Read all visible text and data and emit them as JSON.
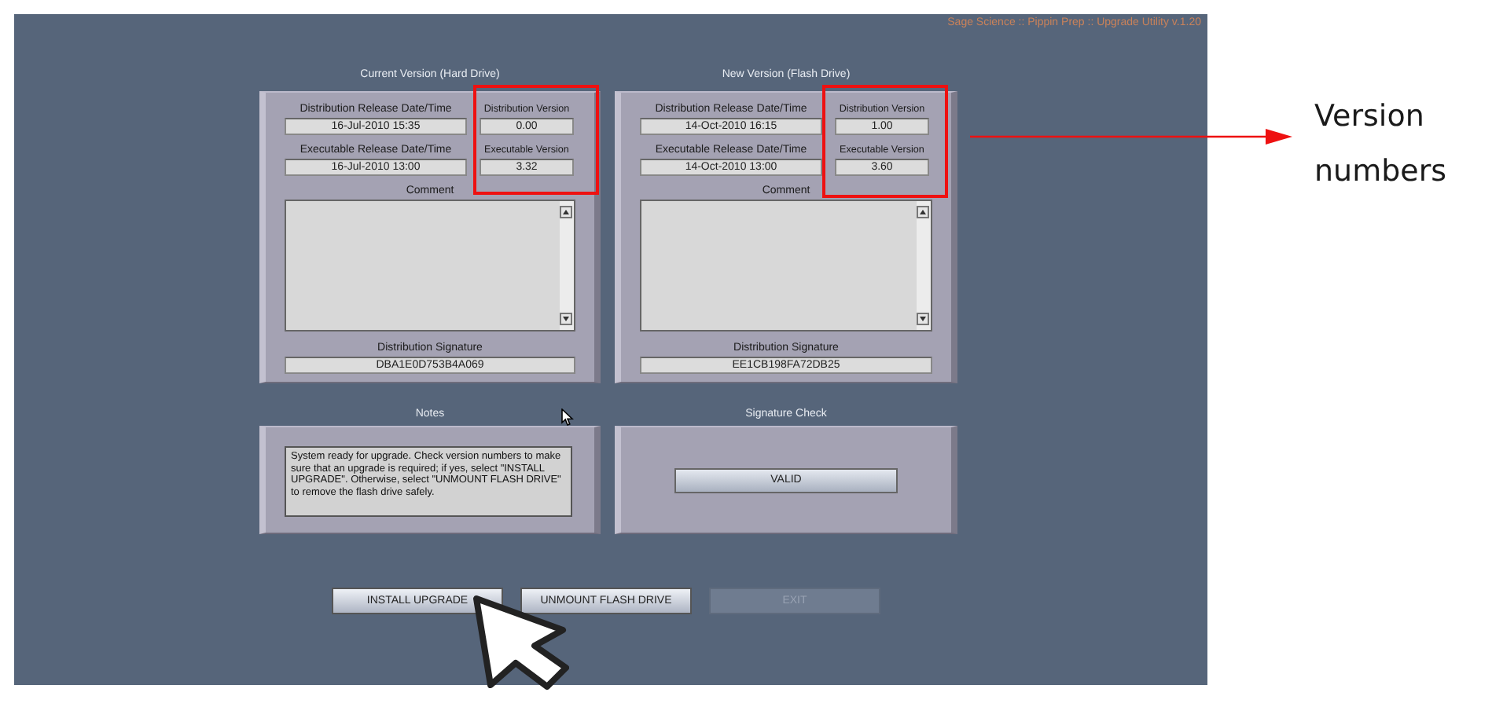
{
  "app_title": "Sage Science :: Pippin Prep :: Upgrade Utility v.1.20",
  "version_panels": [
    {
      "title": "Current Version (Hard Drive)",
      "dist_date_label": "Distribution Release Date/Time",
      "dist_date": "16-Jul-2010   15:35",
      "dist_version_label": "Distribution Version",
      "dist_version": "0.00",
      "exe_date_label": "Executable Release Date/Time",
      "exe_date": "16-Jul-2010   13:00",
      "exe_version_label": "Executable Version",
      "exe_version": "3.32",
      "comment_label": "Comment",
      "signature_label": "Distribution Signature",
      "signature": "DBA1E0D753B4A069"
    },
    {
      "title": "New Version (Flash Drive)",
      "dist_date_label": "Distribution Release Date/Time",
      "dist_date": "14-Oct-2010   16:15",
      "dist_version_label": "Distribution Version",
      "dist_version": "1.00",
      "exe_date_label": "Executable Release Date/Time",
      "exe_date": "14-Oct-2010   13:00",
      "exe_version_label": "Executable Version",
      "exe_version": "3.60",
      "comment_label": "Comment",
      "signature_label": "Distribution Signature",
      "signature": "EE1CB198FA72DB25"
    }
  ],
  "notes": {
    "title": "Notes",
    "text": "System ready for upgrade. Check version numbers to make sure that an upgrade is required; if yes, select \"INSTALL UPGRADE\". Otherwise, select \"UNMOUNT FLASH DRIVE\" to remove the flash drive safely."
  },
  "signature_check": {
    "title": "Signature Check",
    "result": "VALID"
  },
  "buttons": [
    {
      "label": "INSTALL UPGRADE",
      "disabled": false
    },
    {
      "label": "UNMOUNT FLASH DRIVE",
      "disabled": false
    },
    {
      "label": "EXIT",
      "disabled": true
    }
  ],
  "annotation": {
    "label": "Version numbers"
  }
}
